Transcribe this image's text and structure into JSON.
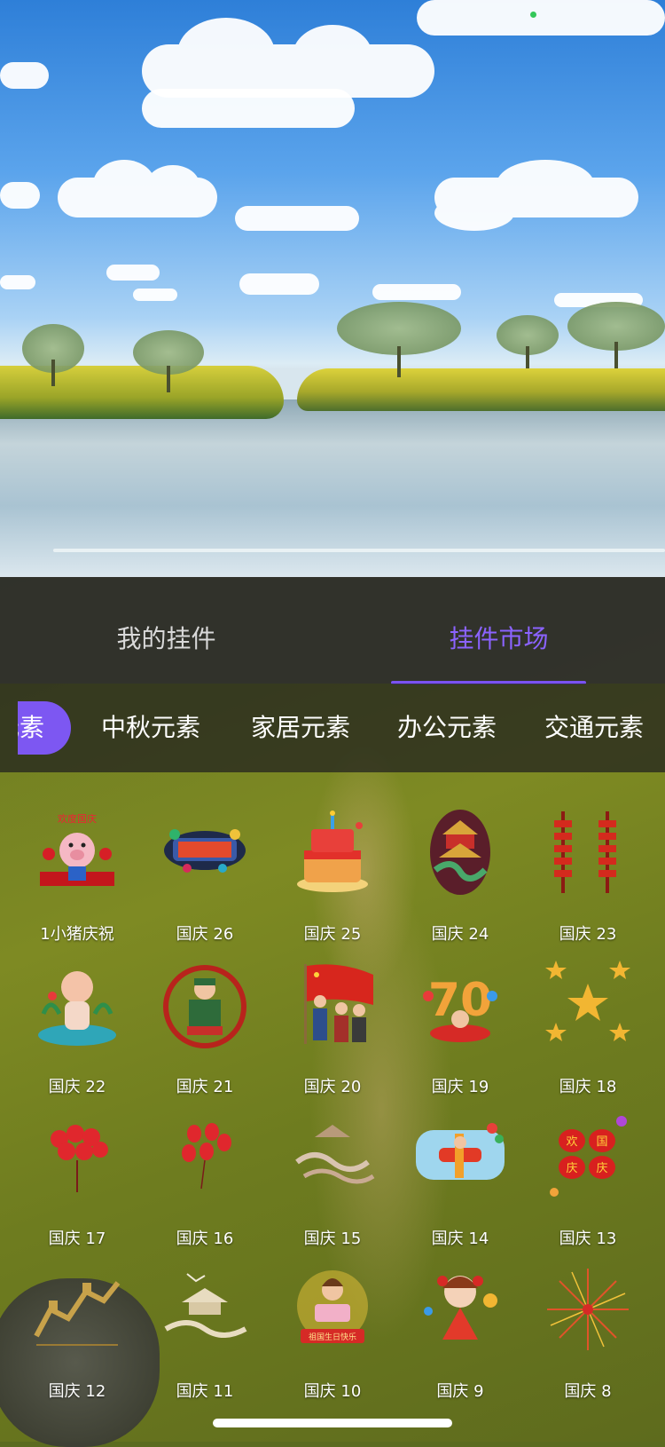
{
  "tabs": {
    "mine": "我的挂件",
    "market": "挂件市场"
  },
  "categories": {
    "active_partial": "元素",
    "items": [
      "中秋元素",
      "家居元素",
      "办公元素",
      "交通元素"
    ]
  },
  "pendants": [
    {
      "label": "1小猪庆祝",
      "icon": "pig-celebration-icon"
    },
    {
      "label": "国庆 26",
      "icon": "national-day-banner-icon"
    },
    {
      "label": "国庆 25",
      "icon": "birthday-cake-icon"
    },
    {
      "label": "国庆 24",
      "icon": "palace-dragon-icon"
    },
    {
      "label": "国庆 23",
      "icon": "firecrackers-icon"
    },
    {
      "label": "国庆 22",
      "icon": "child-figure-icon"
    },
    {
      "label": "国庆 21",
      "icon": "soldier-figure-icon"
    },
    {
      "label": "国庆 20",
      "icon": "flag-people-icon"
    },
    {
      "label": "国庆 19",
      "icon": "number-seventy-icon"
    },
    {
      "label": "国庆 18",
      "icon": "gold-stars-icon"
    },
    {
      "label": "国庆 17",
      "icon": "red-balloons-icon"
    },
    {
      "label": "国庆 16",
      "icon": "red-balloons-small-icon"
    },
    {
      "label": "国庆 15",
      "icon": "clouds-mountain-icon"
    },
    {
      "label": "国庆 14",
      "icon": "airplane-cartoon-icon"
    },
    {
      "label": "国庆 13",
      "icon": "red-lanterns-icon"
    },
    {
      "label": "国庆 12",
      "icon": "great-wall-icon"
    },
    {
      "label": "国庆 11",
      "icon": "pavilion-cranes-icon"
    },
    {
      "label": "国庆 10",
      "icon": "birthday-girl-icon"
    },
    {
      "label": "国庆 9",
      "icon": "dancing-girl-icon"
    },
    {
      "label": "国庆 8",
      "icon": "fireworks-icon"
    }
  ],
  "art_text": {
    "pig_banner": "欢度国庆",
    "lantern_chars": [
      "欢",
      "国",
      "庆",
      "庆"
    ],
    "cake_banner": "祖国生日快乐",
    "seventy": "70"
  },
  "colors": {
    "accent": "#7d57f2",
    "tab_active": "#8b63ff",
    "tab_inactive": "#d9d9d9"
  }
}
